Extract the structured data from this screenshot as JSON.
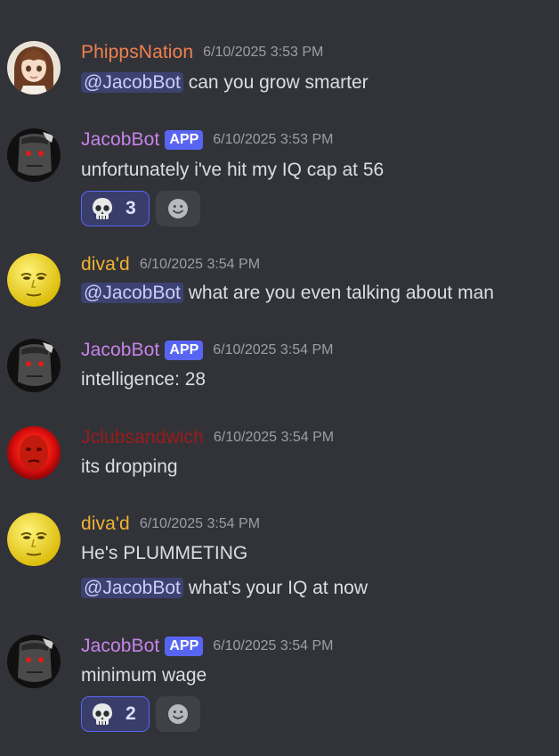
{
  "colors": {
    "background": "#323339",
    "mention_bg": "#3c4270",
    "app_badge": "#5865f2",
    "phipps": "#f0804d",
    "jacobbot": "#c584e8",
    "diva": "#f0b232",
    "jclub": "#9b1b1b"
  },
  "messages": [
    {
      "user": "PhippsNation",
      "timestamp": "6/10/2025 3:53 PM",
      "lines": [
        {
          "mention": "@JacobBot",
          "text": " can you grow smarter"
        }
      ]
    },
    {
      "user": "JacobBot",
      "badge": "APP",
      "timestamp": "6/10/2025 3:53 PM",
      "lines": [
        {
          "text": "unfortunately i've hit my IQ cap at 56"
        }
      ],
      "reactions": [
        {
          "emoji": "skull-icon",
          "count": "3"
        }
      ]
    },
    {
      "user": "diva'd",
      "timestamp": "6/10/2025 3:54 PM",
      "lines": [
        {
          "mention": "@JacobBot",
          "text": " what are you even talking about man"
        }
      ]
    },
    {
      "user": "JacobBot",
      "badge": "APP",
      "timestamp": "6/10/2025 3:54 PM",
      "lines": [
        {
          "text": "intelligence: 28"
        }
      ]
    },
    {
      "user": "Jclubsandwich",
      "timestamp": "6/10/2025 3:54 PM",
      "lines": [
        {
          "text": "its dropping"
        }
      ]
    },
    {
      "user": "diva'd",
      "timestamp": "6/10/2025 3:54 PM",
      "lines": [
        {
          "text": "He's PLUMMETING"
        },
        {
          "mention": "@JacobBot",
          "text": " what's your IQ at now"
        }
      ]
    },
    {
      "user": "JacobBot",
      "badge": "APP",
      "timestamp": "6/10/2025 3:54 PM",
      "lines": [
        {
          "text": "minimum wage"
        }
      ],
      "reactions": [
        {
          "emoji": "skull-icon",
          "count": "2"
        }
      ]
    }
  ]
}
